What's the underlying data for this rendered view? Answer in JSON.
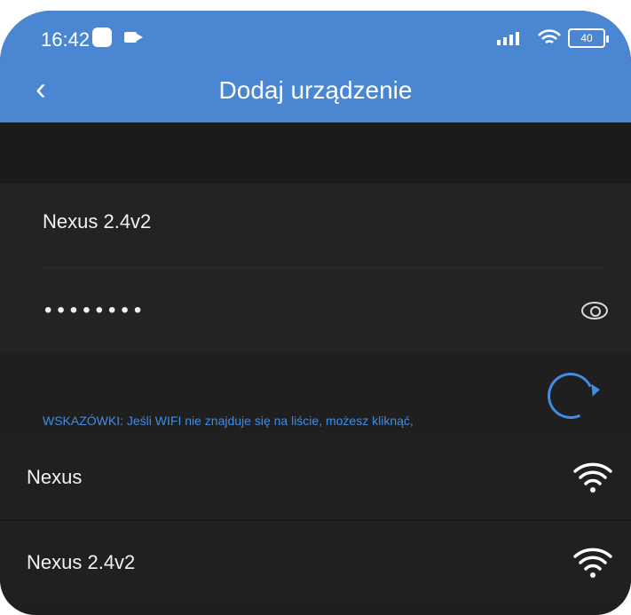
{
  "status": {
    "time": "16:42",
    "battery": "40"
  },
  "header": {
    "title": "Dodaj urządzenie",
    "back_glyph": "‹"
  },
  "form": {
    "ssid": "Nexus 2.4v2",
    "password_mask": "••••••••"
  },
  "hint": {
    "text": "WSKAZÓWKI: Jeśli WIFI nie znajduje się na liście, możesz kliknąć,"
  },
  "networks": [
    {
      "name": "Nexus"
    },
    {
      "name": "Nexus 2.4v2"
    }
  ],
  "colors": {
    "header": "#4a86d2",
    "accent": "#3f8de6",
    "background": "#1f1f1f"
  }
}
